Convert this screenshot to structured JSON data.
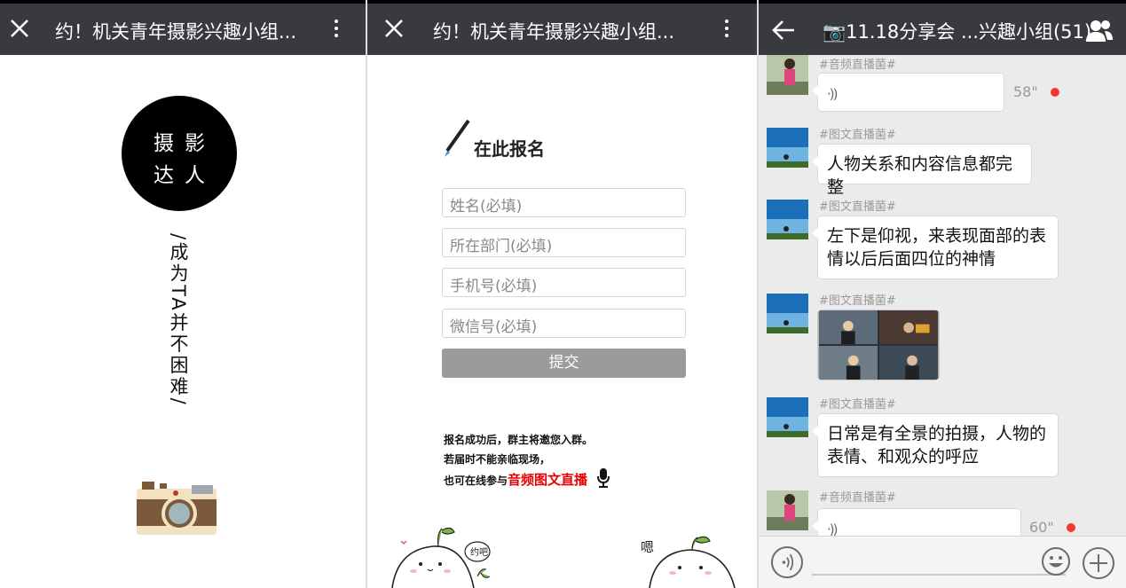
{
  "panel1": {
    "title": "约！机关青年摄影兴趣小组...",
    "badge_line1": "摄影",
    "badge_line2": "达人",
    "vertical_text": "/成为TA并不困难/"
  },
  "panel2": {
    "title": "约！机关青年摄影兴趣小组...",
    "signup_title": "在此报名",
    "fields": [
      {
        "placeholder": "姓名(必填)"
      },
      {
        "placeholder": "所在部门(必填)"
      },
      {
        "placeholder": "手机号(必填)"
      },
      {
        "placeholder": "微信号(必填)"
      }
    ],
    "submit_label": "提交",
    "note_line1": "报名成功后，群主将邀您入群。",
    "note_line2": "若届时不能亲临现场，",
    "note_line3_prefix": "也可在线参与",
    "note_line3_highlight": "音频图文直播",
    "doodle_text1": "约吧",
    "doodle_text2": "嗯"
  },
  "panel3": {
    "title": "📷11.18分享会 ...兴趣小组(51)",
    "messages": [
      {
        "sender": "#音频直播菌#",
        "type": "voice",
        "duration": "58\""
      },
      {
        "sender": "#图文直播菌#",
        "type": "text",
        "text": "人物关系和内容信息都完整"
      },
      {
        "sender": "#图文直播菌#",
        "type": "text",
        "line1": "左下是仰视，来表现面部的表",
        "line2": "情以后后面四位的神情"
      },
      {
        "sender": "#图文直播菌#",
        "type": "image"
      },
      {
        "sender": "#图文直播菌#",
        "type": "text",
        "line1": "日常是有全景的拍摄，人物的",
        "line2": "表情、和观众的呼应"
      },
      {
        "sender": "#音频直播菌#",
        "type": "voice",
        "duration": "60\""
      }
    ],
    "voice_wave": "·))"
  },
  "colors": {
    "topbar": "#393a3f",
    "submit": "#9b9b9b",
    "highlight": "#e60000",
    "unread_dot": "#f43530"
  },
  "icons": [
    "close-icon",
    "more-vertical-icon",
    "back-arrow-icon",
    "group-members-icon",
    "pen-icon",
    "camera-icon",
    "microphone-icon",
    "voice-icon",
    "emoji-icon",
    "plus-icon"
  ]
}
